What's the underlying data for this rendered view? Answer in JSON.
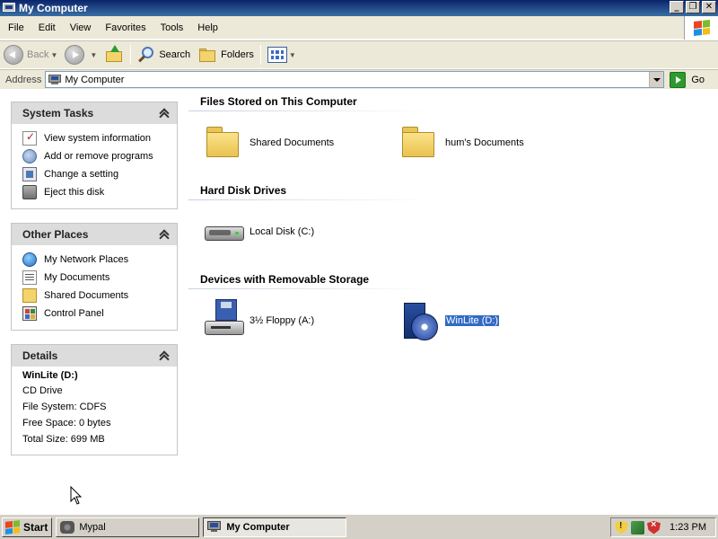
{
  "window": {
    "title": "My Computer",
    "controls": {
      "minimize": "_",
      "maximize": "❐",
      "close": "✕"
    }
  },
  "menu": [
    "File",
    "Edit",
    "View",
    "Favorites",
    "Tools",
    "Help"
  ],
  "toolbar": {
    "back_label": "Back",
    "search_label": "Search",
    "folders_label": "Folders"
  },
  "address": {
    "label": "Address",
    "value": "My Computer",
    "go_label": "Go"
  },
  "panels": {
    "system_tasks": {
      "title": "System Tasks",
      "items": [
        {
          "label": "View system information",
          "icon": "system-info-icon"
        },
        {
          "label": "Add or remove programs",
          "icon": "add-remove-icon"
        },
        {
          "label": "Change a setting",
          "icon": "control-setting-icon"
        },
        {
          "label": "Eject this disk",
          "icon": "eject-icon"
        }
      ]
    },
    "other_places": {
      "title": "Other Places",
      "items": [
        {
          "label": "My Network Places",
          "icon": "network-icon"
        },
        {
          "label": "My Documents",
          "icon": "documents-icon"
        },
        {
          "label": "Shared Documents",
          "icon": "folder-icon"
        },
        {
          "label": "Control Panel",
          "icon": "control-panel-icon"
        }
      ]
    },
    "details": {
      "title": "Details",
      "name": "WinLite (D:)",
      "lines": [
        "CD Drive",
        "File System: CDFS",
        "Free Space: 0 bytes",
        "Total Size: 699 MB"
      ]
    }
  },
  "content": {
    "sections": [
      {
        "title": "Files Stored on This Computer",
        "items": [
          {
            "label": "Shared Documents",
            "icon": "folder-icon"
          },
          {
            "label": "hum's Documents",
            "icon": "folder-icon"
          }
        ]
      },
      {
        "title": "Hard Disk Drives",
        "items": [
          {
            "label": "Local Disk (C:)",
            "icon": "hard-disk-icon"
          }
        ]
      },
      {
        "title": "Devices with Removable Storage",
        "items": [
          {
            "label": "3½ Floppy (A:)",
            "icon": "floppy-icon"
          },
          {
            "label": "WinLite (D:)",
            "icon": "cd-drive-icon",
            "selected": true
          }
        ]
      }
    ]
  },
  "taskbar": {
    "start_label": "Start",
    "tasks": [
      {
        "label": "Mypal",
        "active": false
      },
      {
        "label": "My Computer",
        "active": true
      }
    ],
    "clock": "1:23 PM"
  },
  "colors": {
    "title_bar": "#0a246a",
    "selection": "#316ac5",
    "panel_header": "#dcdcdc",
    "chrome": "#ece9d8"
  }
}
